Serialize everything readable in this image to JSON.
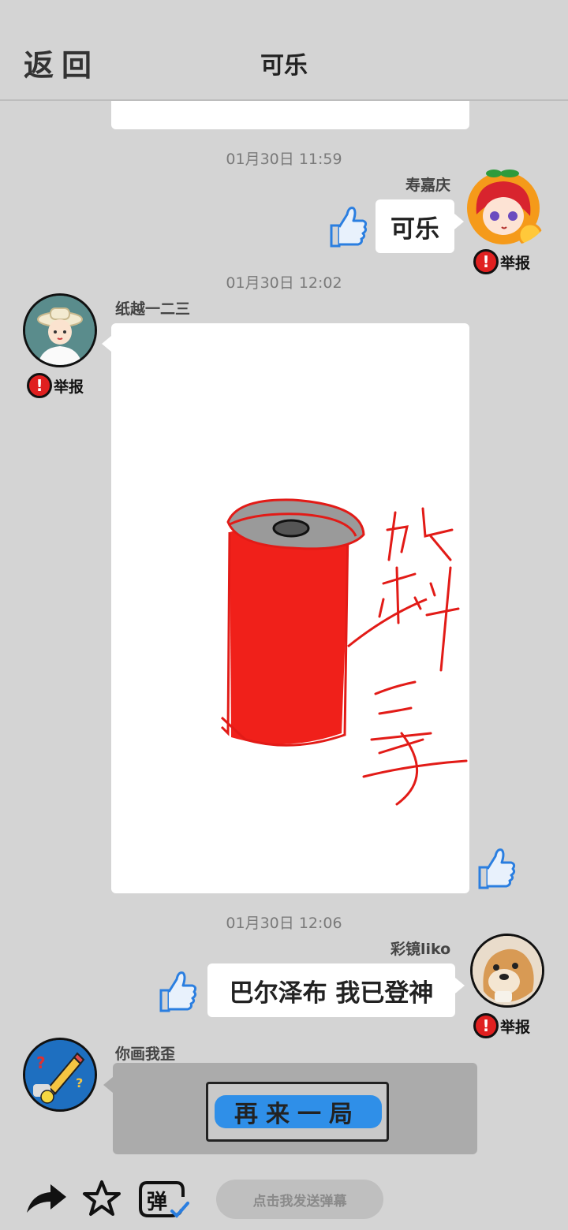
{
  "header": {
    "back_label": "返回",
    "title": "可乐"
  },
  "messages": [
    {
      "timestamp": "01月30日  11:59",
      "user": "寿嘉庆",
      "text": "可乐",
      "report_label": "举报"
    },
    {
      "timestamp": "01月30日  12:02",
      "user": "纸越一二三",
      "drawing_caption": "饮料之子",
      "report_label": "举报"
    },
    {
      "timestamp": "01月30日  12:06",
      "user": "彩镜liko",
      "text": "巴尔泽布 我已登神",
      "report_label": "举报"
    },
    {
      "user": "你画我歪",
      "button_label": "再来一局"
    }
  ],
  "bottom_bar": {
    "danmaku_placeholder": "点击我发送弹幕",
    "danmaku_icon_char": "弹"
  },
  "icons": [
    "share-icon",
    "star-icon",
    "danmaku-icon",
    "thumbs-up-icon",
    "exclamation-icon"
  ],
  "colors": {
    "accent_blue": "#2a7ee0",
    "report_red": "#e02020",
    "drawing_red": "#f0201a"
  }
}
